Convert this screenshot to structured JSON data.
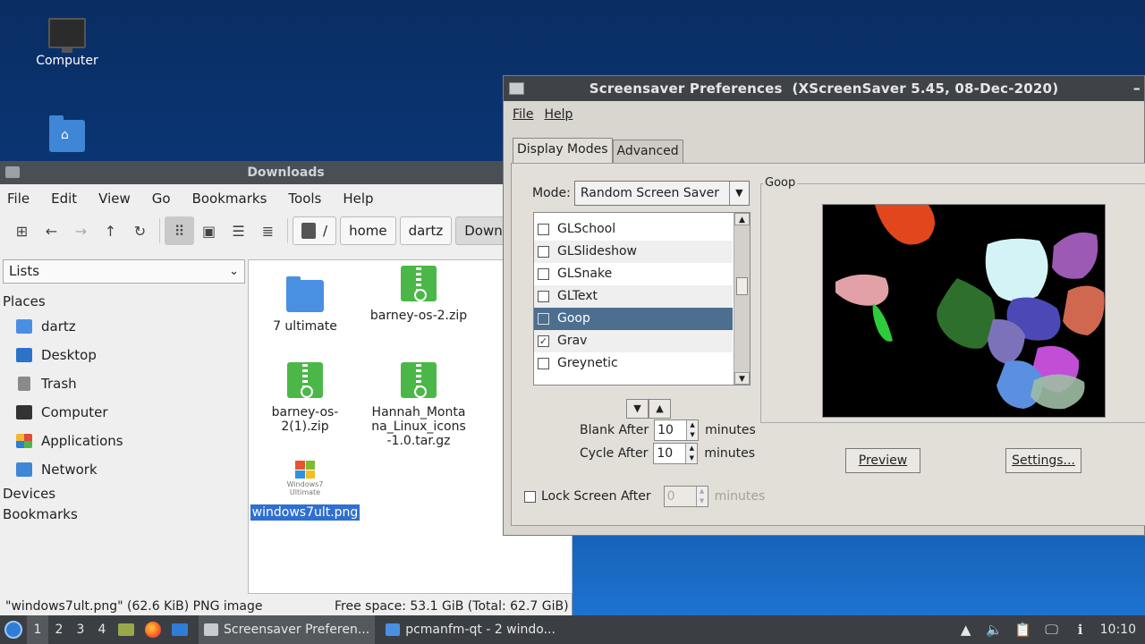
{
  "desktop": {
    "icons": [
      {
        "label": "Computer"
      },
      {
        "label": ""
      }
    ]
  },
  "file_manager": {
    "title": "Downloads",
    "menu": [
      "File",
      "Edit",
      "View",
      "Go",
      "Bookmarks",
      "Tools",
      "Help"
    ],
    "breadcrumbs": [
      "/",
      "home",
      "dartz",
      "Downlo"
    ],
    "side_selector": "Lists",
    "places_header": "Places",
    "places": [
      "dartz",
      "Desktop",
      "Trash",
      "Computer",
      "Applications",
      "Network"
    ],
    "devices_header": "Devices",
    "bookmarks_header": "Bookmarks",
    "files": [
      {
        "name": "7 ultimate",
        "type": "folder"
      },
      {
        "name": "barney-os-2.zip",
        "type": "zip"
      },
      {
        "name": "barney-os-2(1).zip",
        "type": "zip"
      },
      {
        "name": "Hannah_Montana_Linux_icons-1.0.tar.gz",
        "type": "zip"
      },
      {
        "name": "windows7ult.png",
        "type": "image",
        "selected": true
      }
    ],
    "thumb_text": {
      "line1": "Windows7",
      "line2": "Ultimate"
    },
    "status_left": "\"windows7ult.png\" (62.6 KiB) PNG image",
    "status_right": "Free space: 53.1 GiB (Total: 62.7 GiB)"
  },
  "screensaver": {
    "title": "Screensaver Preferences  (XScreenSaver 5.45, 08-Dec-2020)",
    "menu": {
      "file": "File",
      "help": "Help"
    },
    "tabs": {
      "display_modes": "Display Modes",
      "advanced": "Advanced"
    },
    "mode_label": "Mode:",
    "mode_value": "Random Screen Saver",
    "hacks": [
      {
        "name": "GLSchool",
        "checked": false
      },
      {
        "name": "GLSlideshow",
        "checked": false
      },
      {
        "name": "GLSnake",
        "checked": false
      },
      {
        "name": "GLText",
        "checked": false
      },
      {
        "name": "Goop",
        "checked": false,
        "selected": true
      },
      {
        "name": "Grav",
        "checked": true
      },
      {
        "name": "Greynetic",
        "checked": false
      }
    ],
    "blank_after": {
      "label": "Blank After",
      "value": "10",
      "unit": "minutes"
    },
    "cycle_after": {
      "label": "Cycle After",
      "value": "10",
      "unit": "minutes"
    },
    "lock_after": {
      "label": "Lock Screen After",
      "value": "0",
      "unit": "minutes",
      "enabled": false
    },
    "preview_title": "Goop",
    "preview_button": "Preview",
    "settings_button": "Settings..."
  },
  "taskbar": {
    "desktops": [
      "1",
      "2",
      "3",
      "4"
    ],
    "tasks": [
      {
        "label": "Screensaver Preferen..."
      },
      {
        "label": "pcmanfm-qt - 2 windo..."
      }
    ],
    "clock": "10:10"
  }
}
